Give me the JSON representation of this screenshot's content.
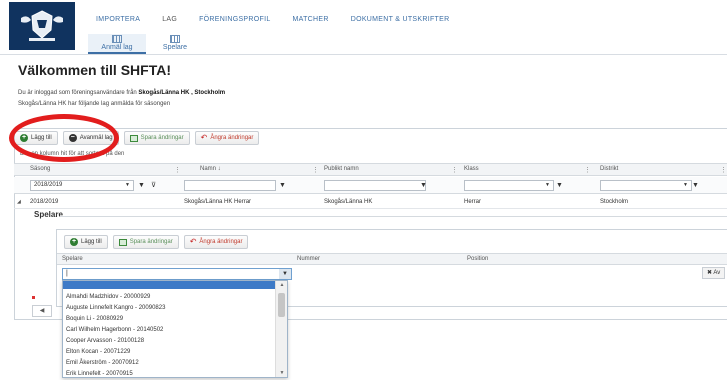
{
  "header": {
    "nav": [
      {
        "label": "IMPORTERA",
        "active": false
      },
      {
        "label": "LAG",
        "active": true
      },
      {
        "label": "FÖRENINGSPROFIL",
        "active": false
      },
      {
        "label": "MATCHER",
        "active": false
      },
      {
        "label": "DOKUMENT & UTSKRIFTER",
        "active": false
      }
    ],
    "subtabs": [
      {
        "label": "Anmäl lag",
        "active": true
      },
      {
        "label": "Spelare",
        "active": false
      }
    ]
  },
  "page": {
    "title": "Välkommen till SHFTA!",
    "login_prefix": "Du är inloggad som föreningsanvändare från ",
    "login_club": "Skogås/Länna HK , Stockholm",
    "registered_text": "Skogås/Länna HK har följande lag anmälda för säsongen"
  },
  "toolbar": {
    "add_label": "Lägg till",
    "unregister_label": "Avanmäl lag",
    "save_label": "Spara ändringar",
    "undo_label": "Ångra ändringar"
  },
  "grid": {
    "group_hint": "Dra en kolumn hit för att sortera på den",
    "columns": [
      "Säsong",
      "Namn ↓",
      "Publikt namn",
      "Klass",
      "Distrikt"
    ],
    "filters": {
      "season": "2018/2019"
    },
    "rows": [
      {
        "season": "2018/2019",
        "name": "Skogås/Länna HK Herrar",
        "public_name": "Skogås/Länna HK",
        "class": "Herrar",
        "district": "Stockholm"
      }
    ]
  },
  "detail": {
    "title": "Spelare",
    "toolbar": {
      "add_label": "Lägg till",
      "save_label": "Spara ändringar",
      "undo_label": "Ångra ändringar"
    },
    "columns": [
      "Spelare",
      "Nummer",
      "Position"
    ],
    "cancel_label": "✖ Av",
    "dropdown_options": [
      "Almahdi Madzhidov - 20000929",
      "Auguste Linnefelt Kangro - 20090823",
      "Boquin Li - 20080929",
      "Carl Wilhelm Hagerbonn - 20140502",
      "Cooper Arvasson - 20100128",
      "Elton Kocan - 20071229",
      "Emil Åkerström - 20070912",
      "Erik Linnefelt - 20070915"
    ]
  },
  "colors": {
    "brand": "#10335f",
    "nav_link": "#3d6fa5",
    "annotation": "#e21d1d",
    "selection": "#3d7ac7"
  }
}
